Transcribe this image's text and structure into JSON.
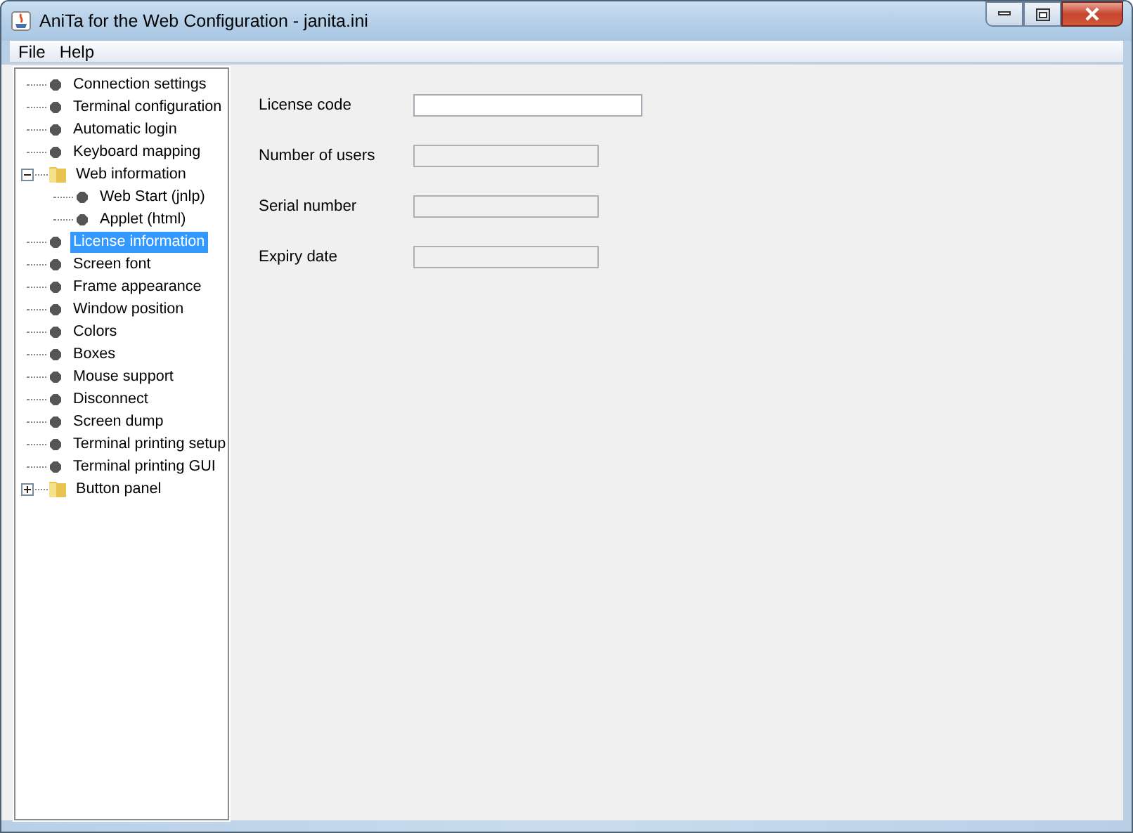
{
  "window": {
    "title": "AniTa for the Web Configuration - janita.ini"
  },
  "menu": [
    "File",
    "Help"
  ],
  "tree": [
    {
      "label": "Connection settings",
      "kind": "leaf",
      "selected": false
    },
    {
      "label": "Terminal configuration",
      "kind": "leaf",
      "selected": false
    },
    {
      "label": "Automatic login",
      "kind": "leaf",
      "selected": false
    },
    {
      "label": "Keyboard mapping",
      "kind": "leaf",
      "selected": false
    },
    {
      "label": "Web information",
      "kind": "folder",
      "expanded": true,
      "selected": false,
      "children": [
        {
          "label": "Web Start (jnlp)",
          "kind": "leaf",
          "selected": false
        },
        {
          "label": "Applet (html)",
          "kind": "leaf",
          "selected": false
        }
      ]
    },
    {
      "label": "License information",
      "kind": "leaf",
      "selected": true
    },
    {
      "label": "Screen font",
      "kind": "leaf",
      "selected": false
    },
    {
      "label": "Frame appearance",
      "kind": "leaf",
      "selected": false
    },
    {
      "label": "Window position",
      "kind": "leaf",
      "selected": false
    },
    {
      "label": "Colors",
      "kind": "leaf",
      "selected": false
    },
    {
      "label": "Boxes",
      "kind": "leaf",
      "selected": false
    },
    {
      "label": "Mouse support",
      "kind": "leaf",
      "selected": false
    },
    {
      "label": "Disconnect",
      "kind": "leaf",
      "selected": false
    },
    {
      "label": "Screen dump",
      "kind": "leaf",
      "selected": false
    },
    {
      "label": "Terminal printing setup",
      "kind": "leaf",
      "selected": false
    },
    {
      "label": "Terminal printing GUI",
      "kind": "leaf",
      "selected": false
    },
    {
      "label": "Button panel",
      "kind": "folder",
      "expanded": false,
      "selected": false
    }
  ],
  "form": [
    {
      "label": "License code",
      "disabled": false
    },
    {
      "label": "Number of users",
      "disabled": true
    },
    {
      "label": "Serial number",
      "disabled": true
    },
    {
      "label": "Expiry date",
      "disabled": true
    }
  ]
}
